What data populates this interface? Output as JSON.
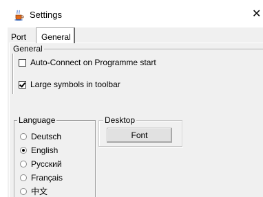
{
  "window": {
    "title": "Settings",
    "close_glyph": "✕",
    "icon": "java-cup-icon"
  },
  "tabs": [
    {
      "label": "Port",
      "selected": false
    },
    {
      "label": "General",
      "selected": true
    }
  ],
  "general": {
    "legend": "General",
    "options": [
      {
        "label": "Auto-Connect on Programme start",
        "checked": false
      },
      {
        "label": "Large symbols in toolbar",
        "checked": true
      }
    ]
  },
  "language": {
    "legend": "Language",
    "options": [
      {
        "label": "Deutsch",
        "selected": false
      },
      {
        "label": "English",
        "selected": true
      },
      {
        "label": "Русский",
        "selected": false
      },
      {
        "label": "Français",
        "selected": false
      },
      {
        "label": "中文",
        "selected": false
      }
    ]
  },
  "desktop": {
    "legend": "Desktop",
    "font_button": "Font"
  }
}
